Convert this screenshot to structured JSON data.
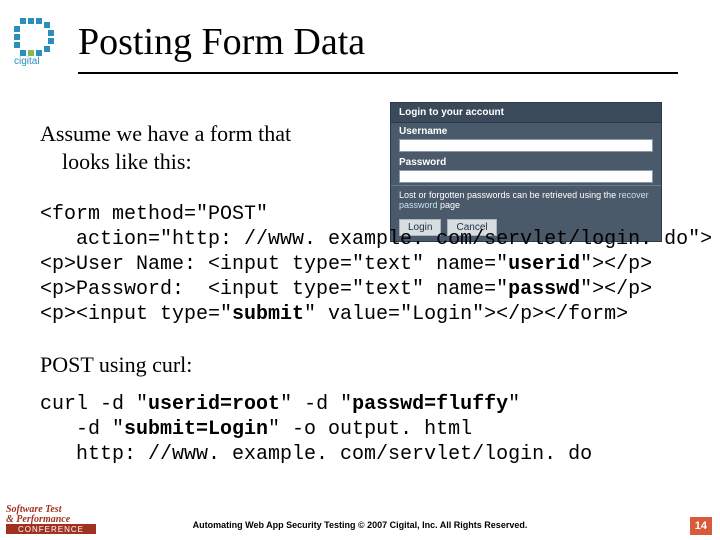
{
  "brand": "cigital",
  "title": "Posting Form Data",
  "intro_line1": "Assume we have a form that",
  "intro_line2": "looks like this:",
  "login_mock": {
    "header": "Login to your account",
    "username_label": "Username",
    "password_label": "Password",
    "note_pre": "Lost or forgotten passwords can be retrieved using the ",
    "note_link": "recover password",
    "note_post": " page",
    "login_btn": "Login",
    "cancel_btn": "Cancel"
  },
  "code1": {
    "l1": "<form method=\"POST\"",
    "l2": "   action=\"http: //www. example. com/servlet/login. do\">",
    "l3a": "<p>User Name: <input type=\"text\" name=\"",
    "l3b": "userid",
    "l3c": "\"></p>",
    "l4a": "<p>Password:  <input type=\"text\" name=\"",
    "l4b": "passwd",
    "l4c": "\"></p>",
    "l5a": "<p><input type=\"",
    "l5b": "submit",
    "l5c": "\" value=\"Login\"></p></form>"
  },
  "post_title": "POST using curl:",
  "code2": {
    "l1a": "curl -d \"",
    "l1b": "userid=root",
    "l1c": "\" -d \"",
    "l1d": "passwd=fluffy",
    "l1e": "\"",
    "l2a": "   -d \"",
    "l2b": "submit=Login",
    "l2c": "\" -o output. html",
    "l3": "   http: //www. example. com/servlet/login. do"
  },
  "footer": "Automating Web App Security Testing   © 2007 Cigital, Inc. All Rights Reserved.",
  "page_number": "14",
  "conf_logo": {
    "l1": "Software Test",
    "l2": "& Performance",
    "l3": "CONFERENCE"
  }
}
